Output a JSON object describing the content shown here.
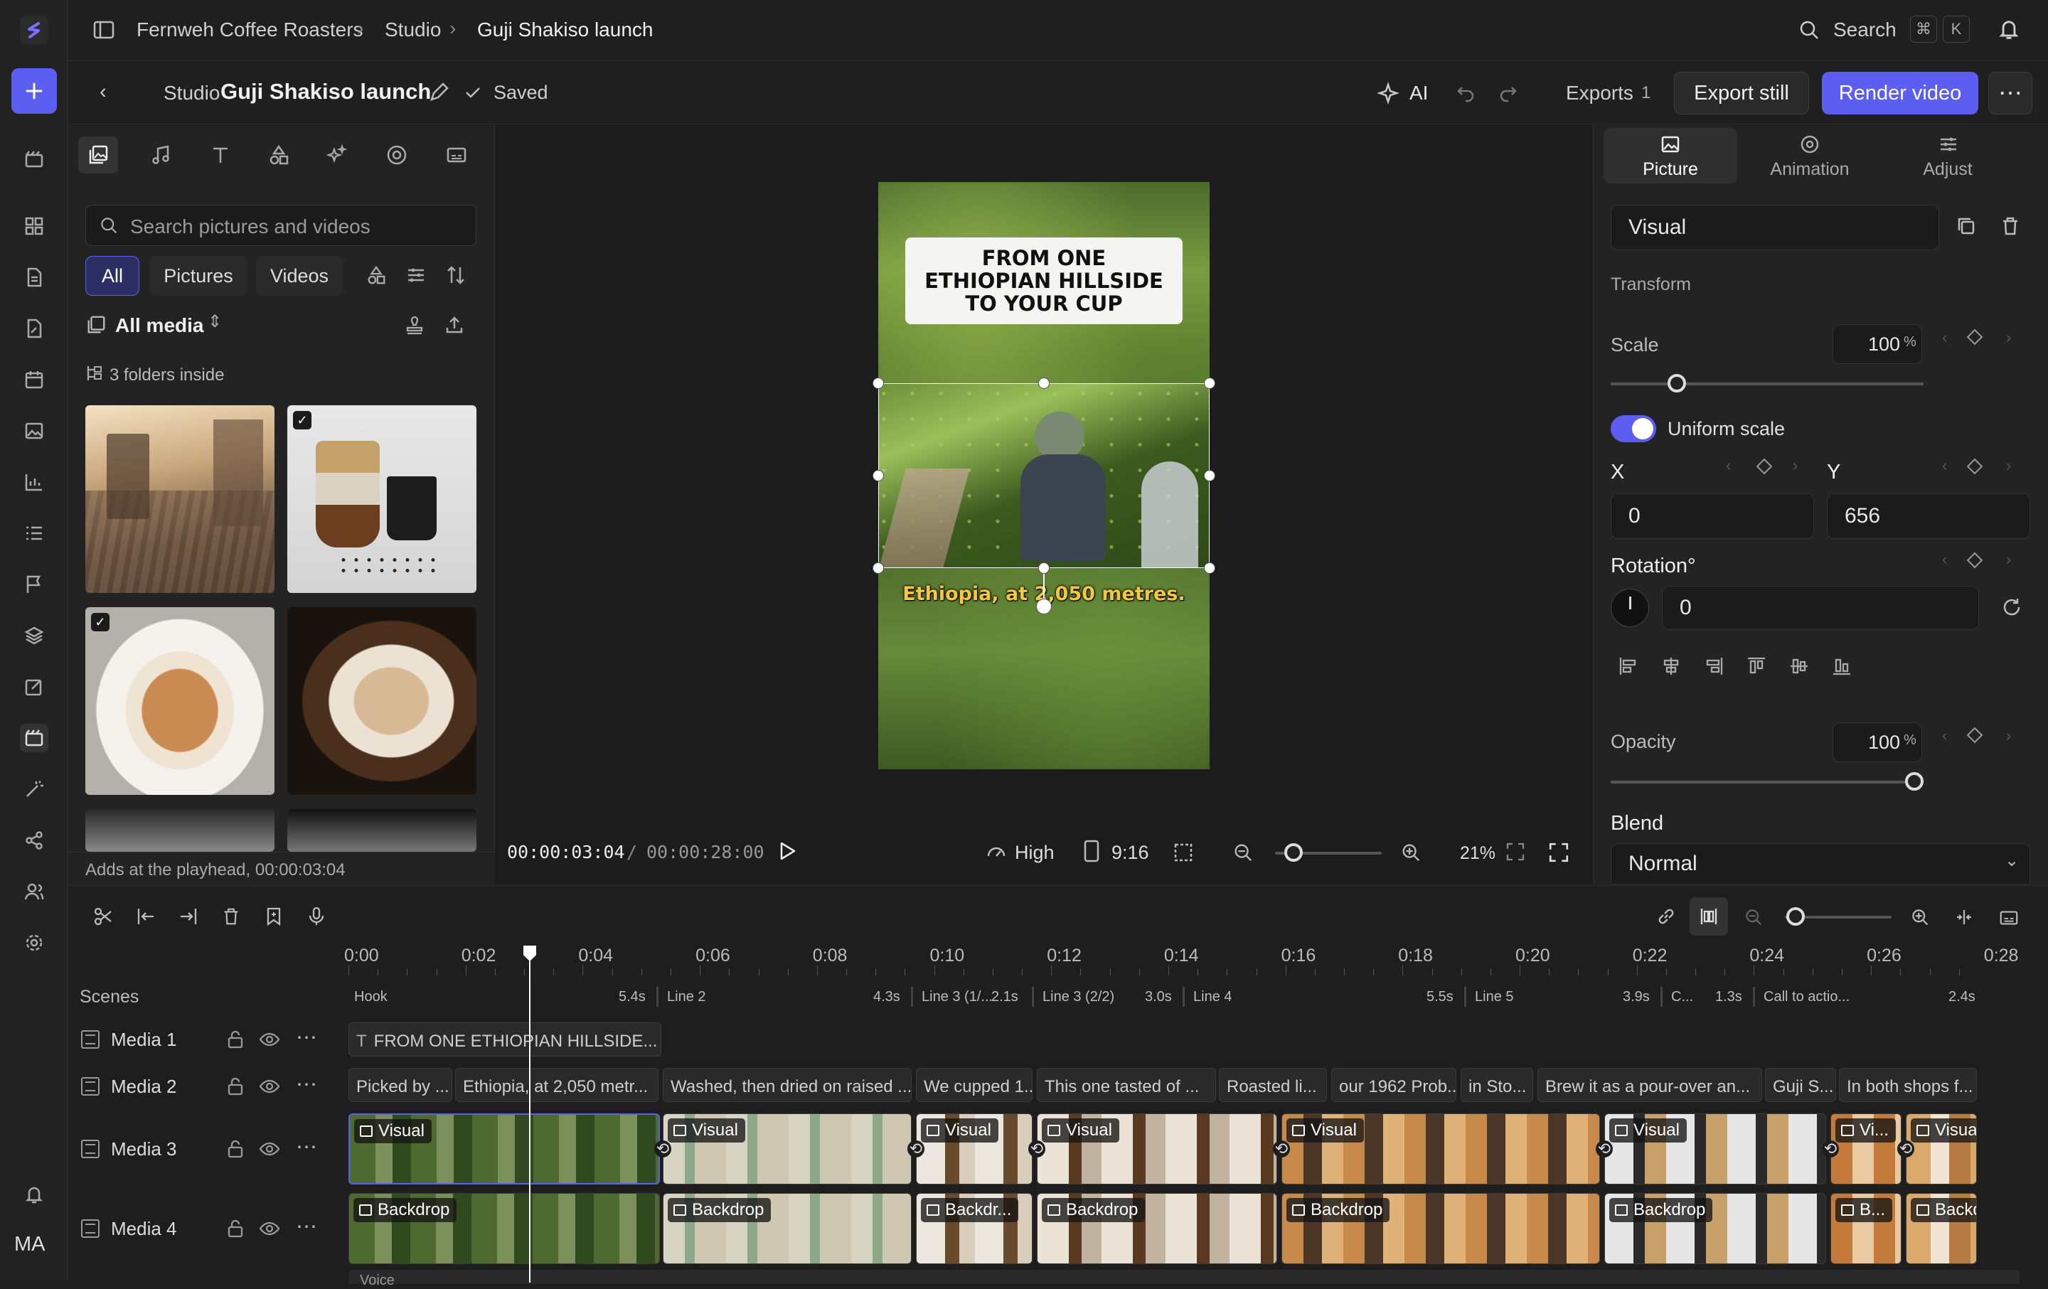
{
  "breadcrumb": {
    "org": "Fernweh Coffee Roasters",
    "section": "Studio",
    "project": "Guji Shakiso launch"
  },
  "search": {
    "label": "Search",
    "key1": "⌘",
    "key2": "K"
  },
  "header": {
    "back_label": "Studio",
    "title": "Guji Shakiso launch",
    "saved_label": "Saved",
    "ai_label": "AI",
    "exports_label": "Exports",
    "exports_count": "1",
    "export_still": "Export still",
    "render_video": "Render video"
  },
  "rail": {
    "avatar_initials": "MA"
  },
  "media": {
    "search_placeholder": "Search pictures and videos",
    "filters": [
      "All",
      "Pictures",
      "Videos"
    ],
    "source": "All media",
    "folders": "3 folders inside",
    "footer": "Adds at the playhead, 00:00:03:04"
  },
  "canvas": {
    "headline": "FROM ONE ETHIOPIAN HILLSIDE TO YOUR CUP",
    "caption": "Ethiopia, at 2,050 metres.",
    "timecode": "00:00:03:04",
    "duration": "00:00:28:00",
    "quality": "High",
    "aspect": "9:16",
    "zoom": "21%",
    "zoom_slider_fraction": 0.17
  },
  "inspector": {
    "tabs": [
      "Picture",
      "Animation",
      "Adjust"
    ],
    "name": "Visual",
    "section_transform": "Transform",
    "scale_label": "Scale",
    "scale_value": "100",
    "unit_pct": "%",
    "uniform_label": "Uniform scale",
    "x_label": "X",
    "x_value": "0",
    "y_label": "Y",
    "y_value": "656",
    "rotation_label": "Rotation°",
    "rotation_value": "0",
    "opacity_label": "Opacity",
    "opacity_value": "100",
    "blend_label": "Blend",
    "blend_value": "Normal"
  },
  "timeline": {
    "ruler": [
      "0:00",
      "0:02",
      "0:04",
      "0:06",
      "0:08",
      "0:10",
      "0:12",
      "0:14",
      "0:16",
      "0:18",
      "0:20",
      "0:22",
      "0:24",
      "0:26",
      "0:28"
    ],
    "scenes_label": "Scenes",
    "tracks": [
      "Media 1",
      "Media 2",
      "Media 3",
      "Media 4"
    ],
    "scenes": [
      {
        "name": "Hook",
        "dur": "5.4s"
      },
      {
        "name": "Line 2",
        "dur": "4.3s"
      },
      {
        "name": "Line 3 (1/...",
        "dur": "2.1s"
      },
      {
        "name": "Line 3 (2/2)",
        "dur": "3.0s"
      },
      {
        "name": "Line 4",
        "dur": "5.5s"
      },
      {
        "name": "Line 5",
        "dur": "3.9s"
      },
      {
        "name": "C...",
        "dur": "1.3s"
      },
      {
        "name": "Call to actio...",
        "dur": "2.4s"
      }
    ],
    "media1_clip": "FROM ONE ETHIOPIAN HILLSIDE...",
    "media2_clips": [
      "Picked by ...",
      "Ethiopia, at 2,050 metr...",
      "Washed, then dried on raised ...",
      "We cupped 1...",
      "This one tasted of ...",
      "Roasted li...",
      "our 1962 Prob...",
      "in Sto...",
      "Brew it as a pour-over an...",
      "Guji S...",
      "In both shops f..."
    ],
    "media3_labels": [
      "Visual",
      "Visual",
      "Visual",
      "Visual",
      "Visual",
      "Visual",
      "Vi...",
      "Visual"
    ],
    "media4_labels": [
      "Backdrop",
      "Backdrop",
      "Backdr...",
      "Backdrop",
      "Backdrop",
      "Backdrop",
      "B...",
      "Backdrop"
    ],
    "voice_label": "Voice"
  },
  "colors": {
    "accent": "#5b5ef0",
    "bg": "#1e1e1e",
    "panel": "#232323",
    "caption_yellow": "#f2c744"
  }
}
